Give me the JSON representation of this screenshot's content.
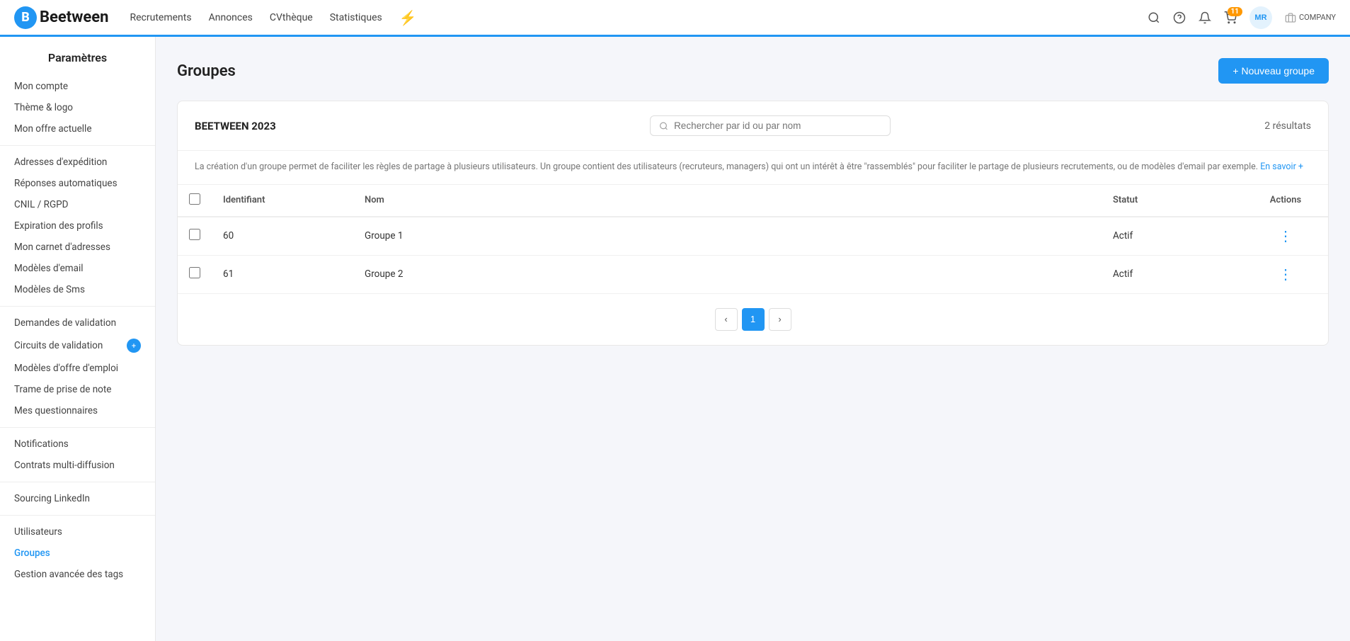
{
  "app": {
    "logo_letter": "B",
    "logo_name": "Beetween"
  },
  "nav": {
    "links": [
      {
        "label": "Recrutements",
        "id": "recrutements"
      },
      {
        "label": "Annonces",
        "id": "annonces"
      },
      {
        "label": "CVthèque",
        "id": "cvtheque"
      },
      {
        "label": "Statistiques",
        "id": "statistiques"
      }
    ],
    "bolt_label": "⚡"
  },
  "nav_right": {
    "search_title": "Rechercher",
    "help_title": "Aide",
    "notifications_title": "Notifications",
    "cart_title": "Panier",
    "cart_badge": "11",
    "avatar": "MR",
    "company_label": "COMPANY"
  },
  "sidebar": {
    "title": "Paramètres",
    "items": [
      {
        "label": "Mon compte",
        "id": "mon-compte",
        "active": false
      },
      {
        "label": "Thème & logo",
        "id": "theme-logo",
        "active": false
      },
      {
        "label": "Mon offre actuelle",
        "id": "mon-offre",
        "active": false
      },
      {
        "divider": true
      },
      {
        "label": "Adresses d'expédition",
        "id": "adresses",
        "active": false
      },
      {
        "label": "Réponses automatiques",
        "id": "reponses-auto",
        "active": false
      },
      {
        "label": "CNIL / RGPD",
        "id": "cnil",
        "active": false
      },
      {
        "label": "Expiration des profils",
        "id": "expiration",
        "active": false
      },
      {
        "label": "Mon carnet d'adresses",
        "id": "carnet",
        "active": false
      },
      {
        "label": "Modèles d'email",
        "id": "modeles-email",
        "active": false
      },
      {
        "label": "Modèles de Sms",
        "id": "modeles-sms",
        "active": false
      },
      {
        "divider": true
      },
      {
        "label": "Demandes de validation",
        "id": "demandes-validation",
        "active": false
      },
      {
        "label": "Circuits de validation",
        "id": "circuits-validation",
        "active": false,
        "badge": true
      },
      {
        "label": "Modèles d'offre d'emploi",
        "id": "modeles-offre",
        "active": false
      },
      {
        "label": "Trame de prise de note",
        "id": "trame",
        "active": false
      },
      {
        "label": "Mes questionnaires",
        "id": "questionnaires",
        "active": false
      },
      {
        "divider": true
      },
      {
        "label": "Notifications",
        "id": "notifications",
        "active": false
      },
      {
        "label": "Contrats multi-diffusion",
        "id": "contrats",
        "active": false
      },
      {
        "divider": true
      },
      {
        "label": "Sourcing LinkedIn",
        "id": "linkedin",
        "active": false
      },
      {
        "divider": true
      },
      {
        "label": "Utilisateurs",
        "id": "utilisateurs",
        "active": false
      },
      {
        "label": "Groupes",
        "id": "groupes",
        "active": true
      },
      {
        "label": "Gestion avancée des tags",
        "id": "tags",
        "active": false
      }
    ]
  },
  "page": {
    "title": "Groupes",
    "new_button_label": "+ Nouveau groupe",
    "section_name": "BEETWEEN 2023",
    "search_placeholder": "Rechercher par id ou par nom",
    "results_count": "2 résultats",
    "description": "La création d'un groupe permet de faciliter les règles de partage à plusieurs utilisateurs. Un groupe contient des utilisateurs (recruteurs, managers) qui ont un intérêt à être \"rassemblés\" pour faciliter le partage de plusieurs recrutements, ou de modèles d'email par exemple.",
    "learn_more": "En savoir +",
    "table": {
      "columns": [
        "Identifiant",
        "Nom",
        "Statut",
        "Actions"
      ],
      "rows": [
        {
          "id": "60",
          "name": "Groupe 1",
          "status": "Actif"
        },
        {
          "id": "61",
          "name": "Groupe 2",
          "status": "Actif"
        }
      ]
    },
    "pagination": {
      "prev": "‹",
      "next": "›",
      "current_page": "1"
    }
  }
}
